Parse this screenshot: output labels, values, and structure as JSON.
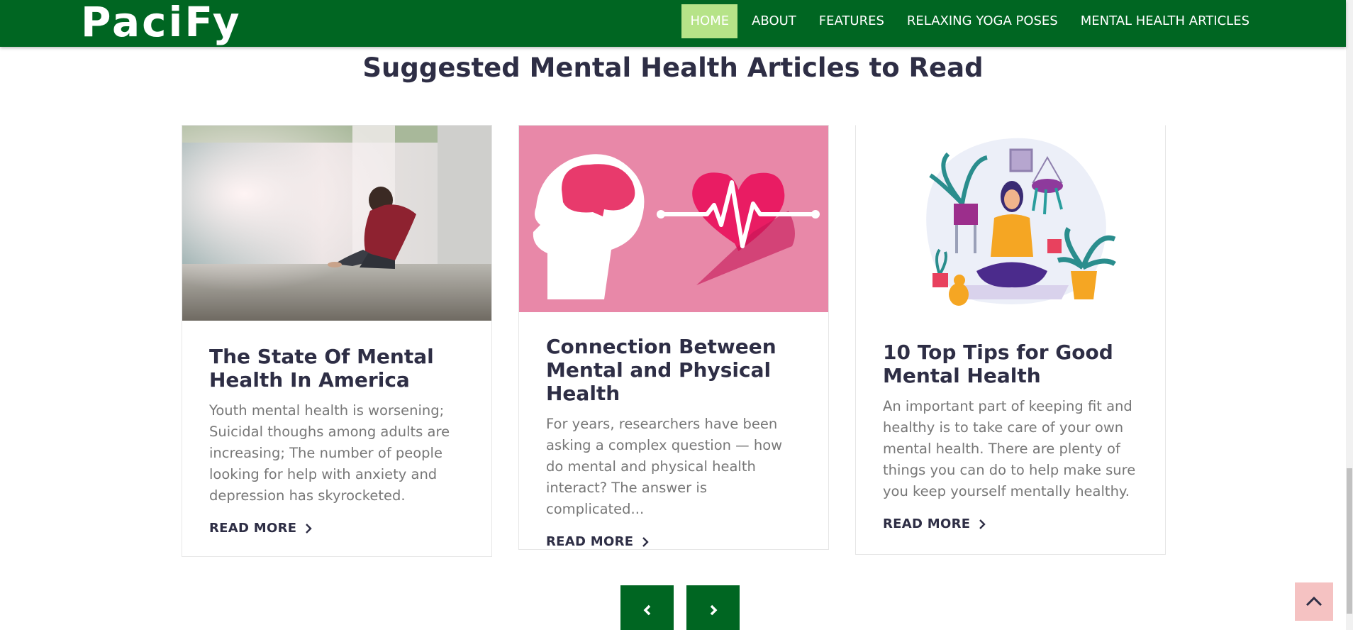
{
  "brand": "PaciFy",
  "nav": {
    "items": [
      "HOME",
      "ABOUT",
      "FEATURES",
      "RELAXING YOGA POSES",
      "MENTAL HEALTH ARTICLES"
    ],
    "active": "HOME",
    "active_color": "#b6e388",
    "bar_color": "#006622"
  },
  "section": {
    "title": "Suggested Mental Health Articles to Read"
  },
  "articles": [
    {
      "title": "The State Of Mental Health In America",
      "excerpt": "Youth mental health is worsening; Suicidal thoughs among adults are increasing; The number of people looking for help with anxiety and depression has skyrocketed.",
      "link": "READ MORE",
      "image": "sad-person-photo"
    },
    {
      "title": "Connection Between Mental and Physical Health",
      "excerpt": "For years, researchers have been asking a complex question — how do mental and physical health interact? The answer is complicated...",
      "link": "READ MORE",
      "image": "brain-heart-illustration"
    },
    {
      "title": "10 Top Tips for Good Mental Health",
      "excerpt": "An important part of keeping fit and healthy is to take care of your own mental health. There are plenty of things you can do to help make sure you keep yourself mentally healthy.",
      "link": "READ MORE",
      "image": "meditation-illustration"
    }
  ],
  "controls": {
    "prev_icon": "chevron-left-icon",
    "next_icon": "chevron-right-icon",
    "top_icon": "chevron-up-icon",
    "top_color": "#f5c2c2"
  }
}
